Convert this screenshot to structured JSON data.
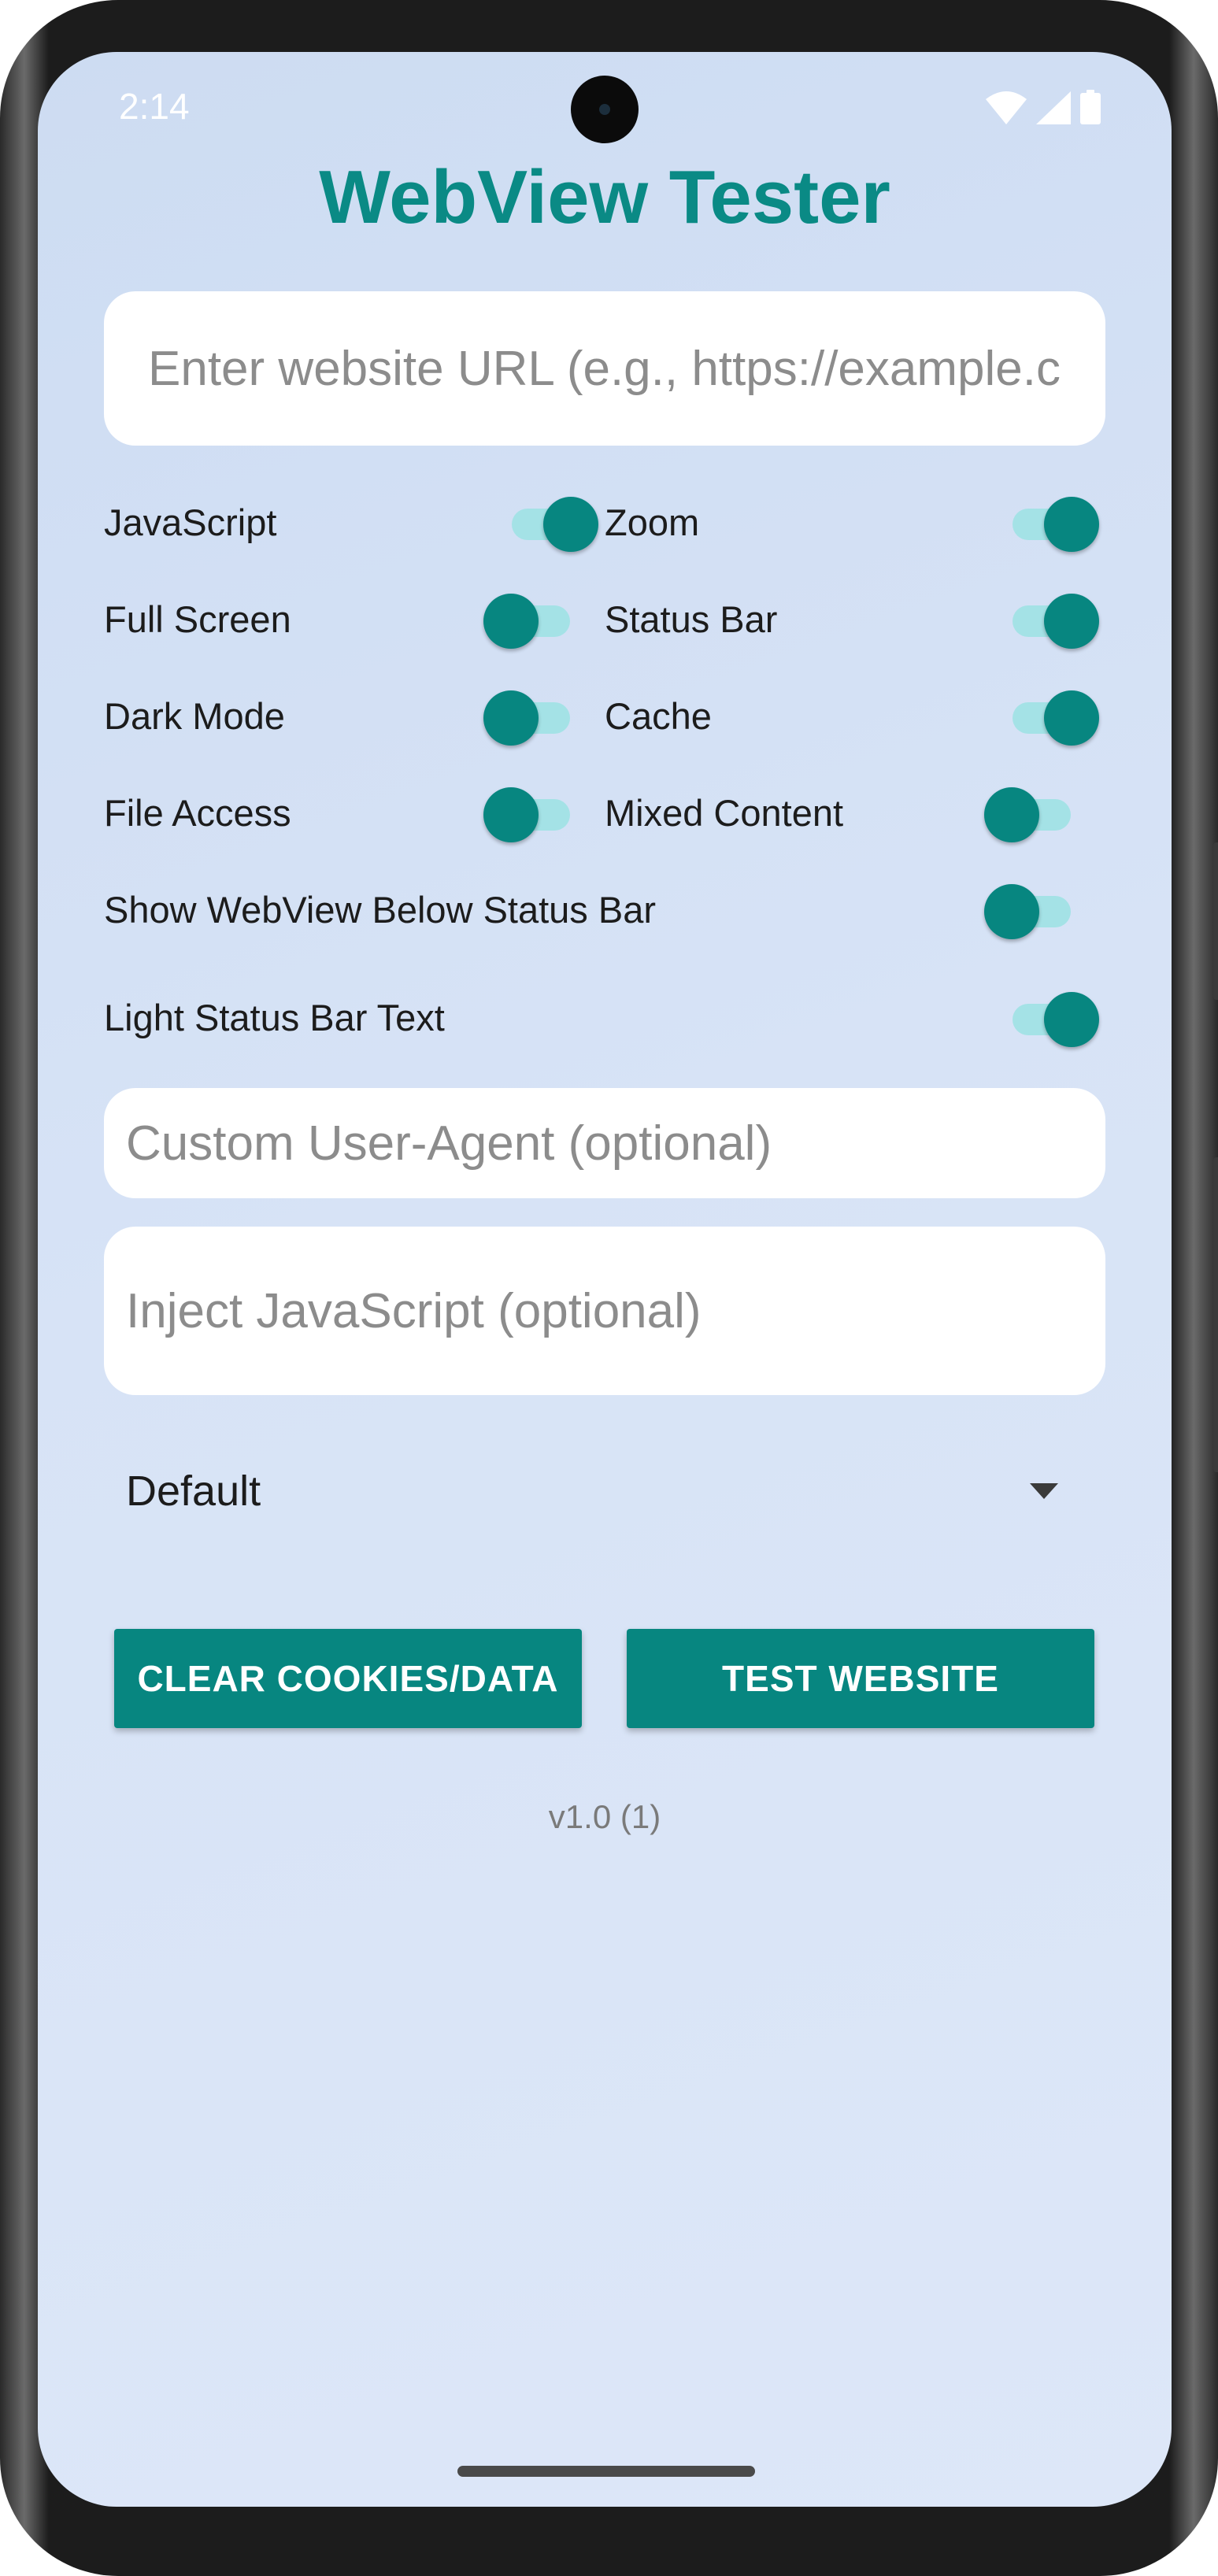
{
  "status_bar": {
    "time": "2:14",
    "icons": [
      "wifi-icon",
      "signal-icon",
      "battery-icon"
    ]
  },
  "app": {
    "title": "WebView Tester",
    "url_placeholder": "Enter website URL (e.g., https://example.c"
  },
  "options": [
    {
      "label": "JavaScript",
      "enabled": true
    },
    {
      "label": "Zoom",
      "enabled": true
    },
    {
      "label": "Full Screen",
      "enabled": false
    },
    {
      "label": "Status Bar",
      "enabled": true
    },
    {
      "label": "Dark Mode",
      "enabled": false
    },
    {
      "label": "Cache",
      "enabled": true
    },
    {
      "label": "File Access",
      "enabled": false
    },
    {
      "label": "Mixed Content",
      "enabled": false
    },
    {
      "label": "Show WebView Below Status Bar",
      "enabled": false
    },
    {
      "label": "Light Status Bar Text",
      "enabled": true
    }
  ],
  "fields": {
    "user_agent_placeholder": "Custom User-Agent (optional)",
    "inject_js_placeholder": "Inject JavaScript (optional)"
  },
  "dropdown": {
    "selected": "Default"
  },
  "buttons": {
    "clear": "CLEAR COOKIES/DATA",
    "test": "TEST WEBSITE"
  },
  "version": "v1.0 (1)",
  "colors": {
    "accent": "#078680",
    "title": "#0a8a85",
    "track": "#a4e2e6",
    "background": "#d7e3f6"
  }
}
